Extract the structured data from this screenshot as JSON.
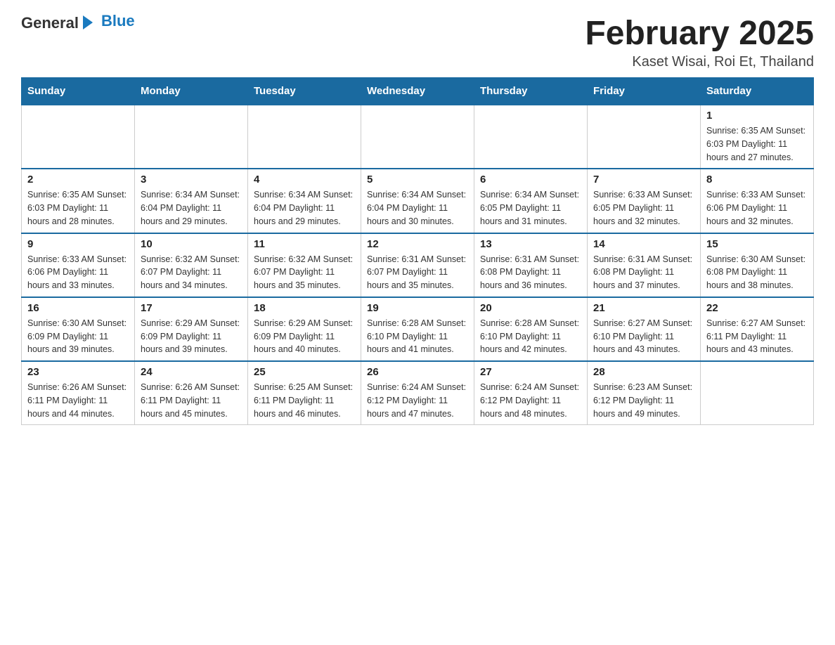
{
  "header": {
    "logo_general": "General",
    "logo_blue": "Blue",
    "title": "February 2025",
    "location": "Kaset Wisai, Roi Et, Thailand"
  },
  "days_of_week": [
    "Sunday",
    "Monday",
    "Tuesday",
    "Wednesday",
    "Thursday",
    "Friday",
    "Saturday"
  ],
  "weeks": [
    [
      {
        "day": "",
        "info": ""
      },
      {
        "day": "",
        "info": ""
      },
      {
        "day": "",
        "info": ""
      },
      {
        "day": "",
        "info": ""
      },
      {
        "day": "",
        "info": ""
      },
      {
        "day": "",
        "info": ""
      },
      {
        "day": "1",
        "info": "Sunrise: 6:35 AM\nSunset: 6:03 PM\nDaylight: 11 hours and 27 minutes."
      }
    ],
    [
      {
        "day": "2",
        "info": "Sunrise: 6:35 AM\nSunset: 6:03 PM\nDaylight: 11 hours and 28 minutes."
      },
      {
        "day": "3",
        "info": "Sunrise: 6:34 AM\nSunset: 6:04 PM\nDaylight: 11 hours and 29 minutes."
      },
      {
        "day": "4",
        "info": "Sunrise: 6:34 AM\nSunset: 6:04 PM\nDaylight: 11 hours and 29 minutes."
      },
      {
        "day": "5",
        "info": "Sunrise: 6:34 AM\nSunset: 6:04 PM\nDaylight: 11 hours and 30 minutes."
      },
      {
        "day": "6",
        "info": "Sunrise: 6:34 AM\nSunset: 6:05 PM\nDaylight: 11 hours and 31 minutes."
      },
      {
        "day": "7",
        "info": "Sunrise: 6:33 AM\nSunset: 6:05 PM\nDaylight: 11 hours and 32 minutes."
      },
      {
        "day": "8",
        "info": "Sunrise: 6:33 AM\nSunset: 6:06 PM\nDaylight: 11 hours and 32 minutes."
      }
    ],
    [
      {
        "day": "9",
        "info": "Sunrise: 6:33 AM\nSunset: 6:06 PM\nDaylight: 11 hours and 33 minutes."
      },
      {
        "day": "10",
        "info": "Sunrise: 6:32 AM\nSunset: 6:07 PM\nDaylight: 11 hours and 34 minutes."
      },
      {
        "day": "11",
        "info": "Sunrise: 6:32 AM\nSunset: 6:07 PM\nDaylight: 11 hours and 35 minutes."
      },
      {
        "day": "12",
        "info": "Sunrise: 6:31 AM\nSunset: 6:07 PM\nDaylight: 11 hours and 35 minutes."
      },
      {
        "day": "13",
        "info": "Sunrise: 6:31 AM\nSunset: 6:08 PM\nDaylight: 11 hours and 36 minutes."
      },
      {
        "day": "14",
        "info": "Sunrise: 6:31 AM\nSunset: 6:08 PM\nDaylight: 11 hours and 37 minutes."
      },
      {
        "day": "15",
        "info": "Sunrise: 6:30 AM\nSunset: 6:08 PM\nDaylight: 11 hours and 38 minutes."
      }
    ],
    [
      {
        "day": "16",
        "info": "Sunrise: 6:30 AM\nSunset: 6:09 PM\nDaylight: 11 hours and 39 minutes."
      },
      {
        "day": "17",
        "info": "Sunrise: 6:29 AM\nSunset: 6:09 PM\nDaylight: 11 hours and 39 minutes."
      },
      {
        "day": "18",
        "info": "Sunrise: 6:29 AM\nSunset: 6:09 PM\nDaylight: 11 hours and 40 minutes."
      },
      {
        "day": "19",
        "info": "Sunrise: 6:28 AM\nSunset: 6:10 PM\nDaylight: 11 hours and 41 minutes."
      },
      {
        "day": "20",
        "info": "Sunrise: 6:28 AM\nSunset: 6:10 PM\nDaylight: 11 hours and 42 minutes."
      },
      {
        "day": "21",
        "info": "Sunrise: 6:27 AM\nSunset: 6:10 PM\nDaylight: 11 hours and 43 minutes."
      },
      {
        "day": "22",
        "info": "Sunrise: 6:27 AM\nSunset: 6:11 PM\nDaylight: 11 hours and 43 minutes."
      }
    ],
    [
      {
        "day": "23",
        "info": "Sunrise: 6:26 AM\nSunset: 6:11 PM\nDaylight: 11 hours and 44 minutes."
      },
      {
        "day": "24",
        "info": "Sunrise: 6:26 AM\nSunset: 6:11 PM\nDaylight: 11 hours and 45 minutes."
      },
      {
        "day": "25",
        "info": "Sunrise: 6:25 AM\nSunset: 6:11 PM\nDaylight: 11 hours and 46 minutes."
      },
      {
        "day": "26",
        "info": "Sunrise: 6:24 AM\nSunset: 6:12 PM\nDaylight: 11 hours and 47 minutes."
      },
      {
        "day": "27",
        "info": "Sunrise: 6:24 AM\nSunset: 6:12 PM\nDaylight: 11 hours and 48 minutes."
      },
      {
        "day": "28",
        "info": "Sunrise: 6:23 AM\nSunset: 6:12 PM\nDaylight: 11 hours and 49 minutes."
      },
      {
        "day": "",
        "info": ""
      }
    ]
  ]
}
